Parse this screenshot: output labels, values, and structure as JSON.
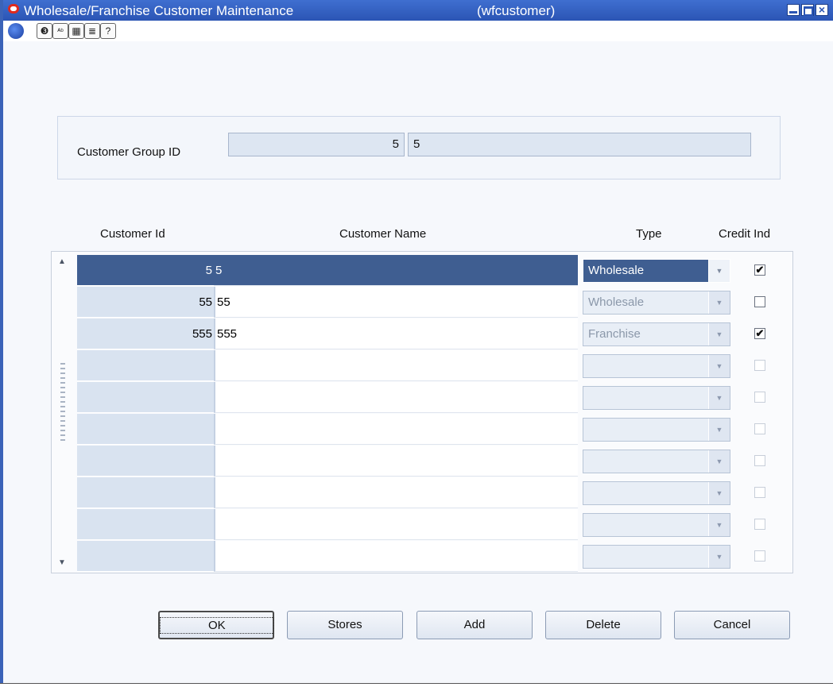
{
  "window": {
    "title": "Wholesale/Franchise Customer Maintenance",
    "ident": "(wfcustomer)"
  },
  "toolbar": {
    "icons": [
      "globe-icon",
      "help-icon",
      "spell-icon",
      "calendar-icon",
      "notes-icon",
      "question-icon"
    ]
  },
  "header": {
    "customer_group_label": "Customer Group ID",
    "customer_group_id": "5",
    "customer_group_name": "5"
  },
  "grid": {
    "columns": [
      "Customer Id",
      "Customer Name",
      "Type",
      "Credit Ind"
    ],
    "rows": [
      {
        "id": "5",
        "name": "5",
        "type": "Wholesale",
        "credit": "✔",
        "selected": true
      },
      {
        "id": "55",
        "name": "55",
        "type": "Wholesale",
        "credit": "",
        "selected": false
      },
      {
        "id": "555",
        "name": "555",
        "type": "Franchise",
        "credit": "✔",
        "selected": false
      },
      {
        "id": "",
        "name": "",
        "type": "",
        "credit": "",
        "selected": false
      },
      {
        "id": "",
        "name": "",
        "type": "",
        "credit": "",
        "selected": false
      },
      {
        "id": "",
        "name": "",
        "type": "",
        "credit": "",
        "selected": false
      },
      {
        "id": "",
        "name": "",
        "type": "",
        "credit": "",
        "selected": false
      },
      {
        "id": "",
        "name": "",
        "type": "",
        "credit": "",
        "selected": false
      },
      {
        "id": "",
        "name": "",
        "type": "",
        "credit": "",
        "selected": false
      },
      {
        "id": "",
        "name": "",
        "type": "",
        "credit": "",
        "selected": false
      }
    ]
  },
  "buttons": {
    "ok": "OK",
    "stores": "Stores",
    "add": "Add",
    "delete": "Delete",
    "cancel": "Cancel"
  }
}
